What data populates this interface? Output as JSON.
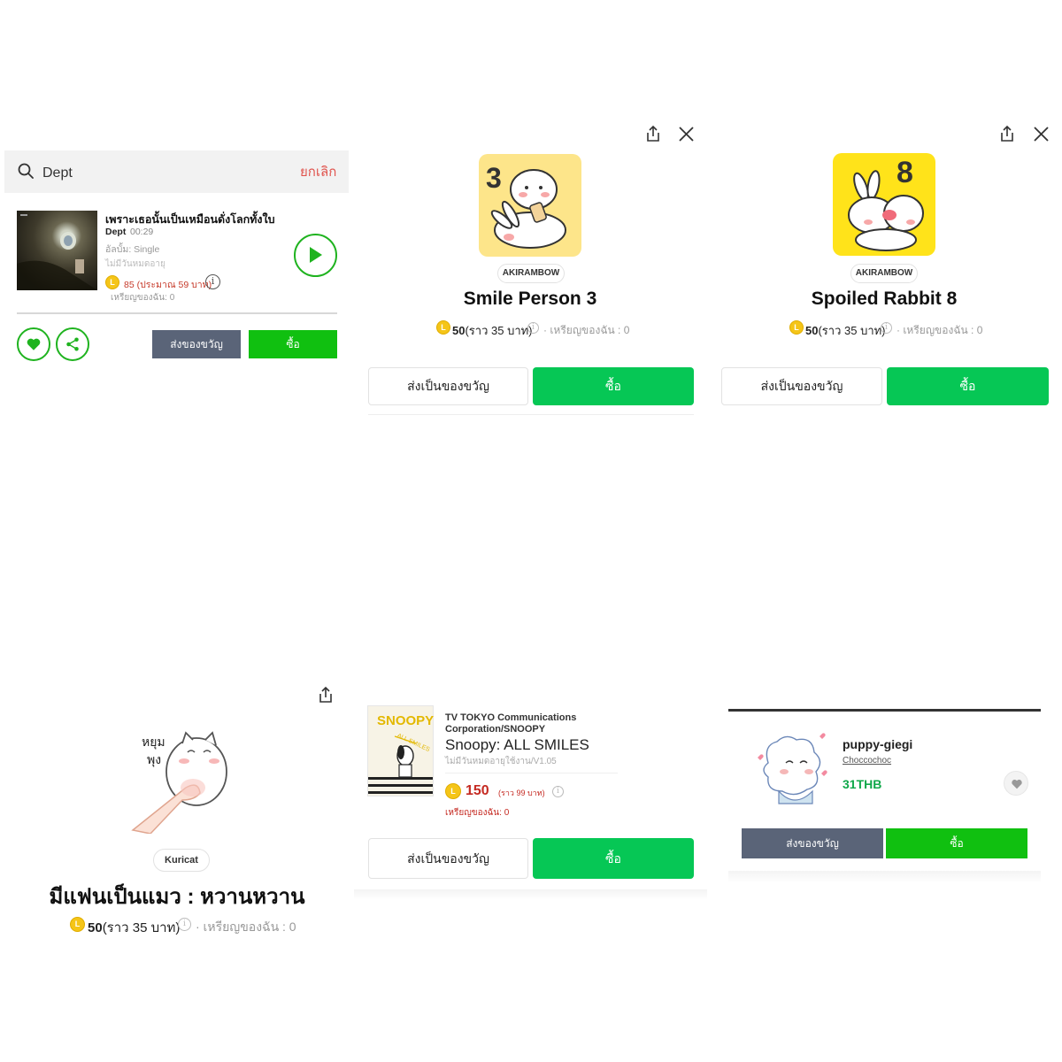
{
  "music": {
    "search_query": "Dept",
    "cancel_label": "ยกเลิก",
    "song": {
      "title": "เพราะเธอนั้นเป็นเหมือนดั่งโลกทั้งใบ",
      "artist": "Dept",
      "duration": "00:29",
      "album": "อัลบั้ม: Single",
      "expiry": "ไม่มีวันหมดอายุ",
      "coin_badge": "L",
      "price": "85 (ประมาณ 59 บาท)",
      "info_glyph": "i",
      "my_coins": "เหรียญของฉัน: 0"
    },
    "gift_label": "ส่งของขวัญ",
    "buy_label": "ซื้อ"
  },
  "sticker_smile": {
    "badge_number": "3",
    "author": "AKIRAMBOW",
    "title": "Smile Person 3",
    "coin_badge": "L",
    "price_value": "50",
    "price_approx": "(ราว 35 บาท)",
    "info_glyph": "i",
    "my_coins": "· เหรียญของฉัน : 0",
    "gift_label": "ส่งเป็นของขวัญ",
    "buy_label": "ซื้อ"
  },
  "sticker_rabbit": {
    "badge_number": "8",
    "author": "AKIRAMBOW",
    "title": "Spoiled Rabbit 8",
    "coin_badge": "L",
    "price_value": "50",
    "price_approx": "(ราว 35 บาท)",
    "info_glyph": "i",
    "my_coins": "· เหรียญของฉัน : 0",
    "gift_label": "ส่งเป็นของขวัญ",
    "buy_label": "ซื้อ"
  },
  "sticker_cat": {
    "image_text_1": "หยุม",
    "image_text_2": "พุง",
    "author": "Kuricat",
    "title": "มีแฟนเป็นแมว : หวานหวาน",
    "coin_badge": "L",
    "price_value": "50",
    "price_approx": "(ราว 35 บาท)",
    "info_glyph": "i",
    "my_coins": "· เหรียญของฉัน : 0"
  },
  "theme_snoopy": {
    "publisher": "TV TOKYO Communications Corporation/SNOOPY",
    "title": "Snoopy: ALL SMILES",
    "validity": "ไม่มีวันหมดอายุใช้งาน/V1.05",
    "coin_badge": "L",
    "price_value": "150",
    "price_approx": "(ราว 99 บาท)",
    "info_glyph": "i",
    "my_coins": "เหรียญของฉัน: 0",
    "thumb_text": "SNOOPY",
    "thumb_sub": "ALL SMILES",
    "gift_label": "ส่งเป็นของขวัญ",
    "buy_label": "ซื้อ"
  },
  "sticker_puppy": {
    "title": "puppy-giegi",
    "author": "Choccochoc",
    "price": "31THB",
    "gift_label": "ส่งของขวัญ",
    "buy_label": "ซื้อ"
  },
  "colors": {
    "line_green": "#06c755",
    "button_green": "#10c010",
    "gift_slate": "#5a6478",
    "price_red": "#c52a22",
    "coin_gold": "#f5c518"
  }
}
